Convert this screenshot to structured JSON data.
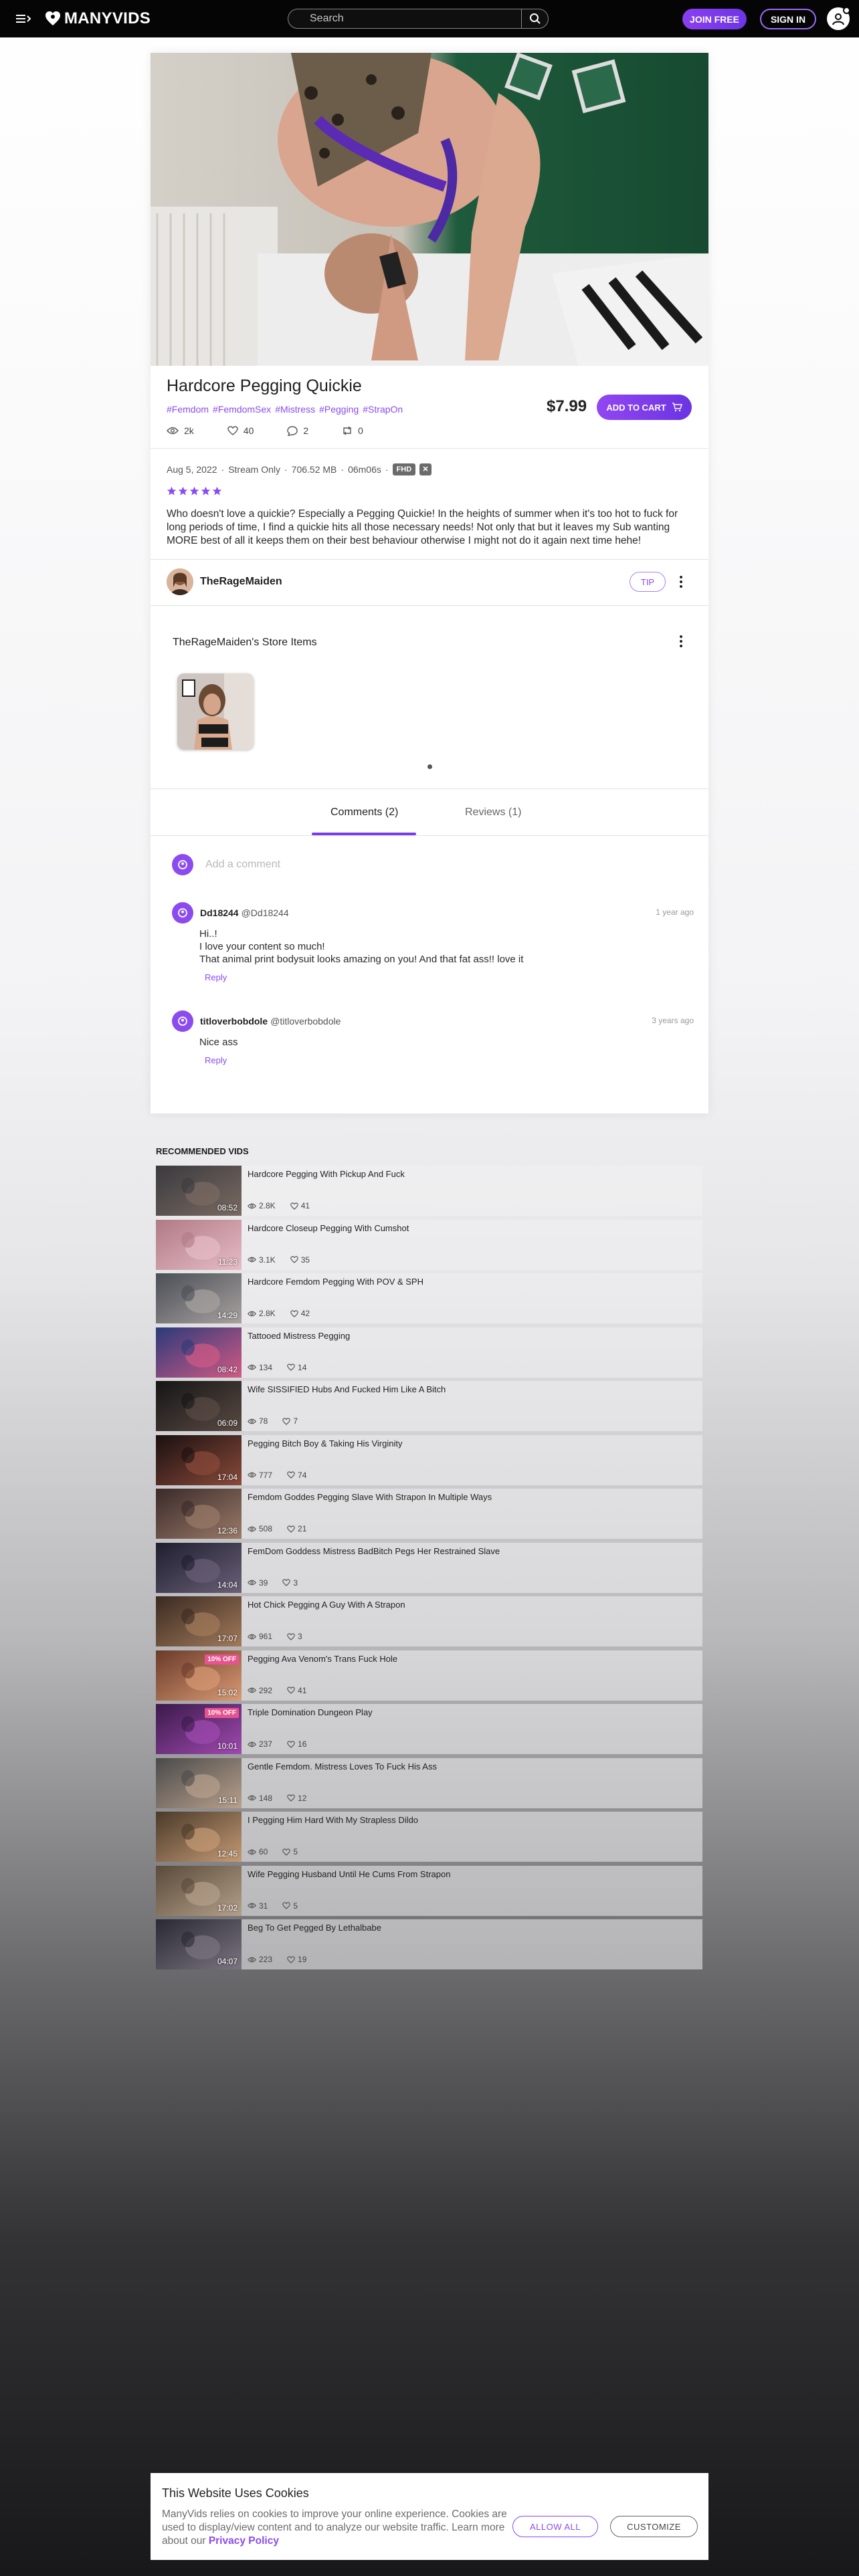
{
  "header": {
    "logo_text": "MANYVIDS",
    "search_placeholder": "Search",
    "join_label": "JOIN FREE",
    "signin_label": "SIGN IN"
  },
  "video": {
    "title": "Hardcore Pegging Quickie",
    "tags": [
      "#Femdom",
      "#FemdomSex",
      "#Mistress",
      "#Pegging",
      "#StrapOn"
    ],
    "stats": {
      "views": "2k",
      "likes": "40",
      "comments": "2",
      "reposts": "0"
    },
    "price": "$7.99",
    "add_to_cart_label": "ADD TO CART",
    "date": "Aug 5, 2022",
    "stream": "Stream Only",
    "size": "706.52 MB",
    "duration": "06m06s",
    "quality_badge": "FHD",
    "rating_stars": 5,
    "description": "Who doesn't love a quickie? Especially a Pegging Quickie! In the heights of summer when it's too hot to fuck for long periods of time, I find a quickie hits all those necessary needs! Not only that but it leaves my Sub wanting MORE best of all it keeps them on their best behaviour otherwise I might not do it again next time hehe!"
  },
  "creator": {
    "name": "TheRageMaiden",
    "tip_label": "TIP"
  },
  "store": {
    "title": "TheRageMaiden's Store Items"
  },
  "tabs": {
    "comments": "Comments (2)",
    "reviews": "Reviews (1)"
  },
  "comment_input_placeholder": "Add a comment",
  "comments": [
    {
      "user": "Dd18244",
      "handle": "@Dd18244",
      "time": "1 year ago",
      "lines": [
        "Hi..!",
        "I love your content so much!",
        "That animal print bodysuit looks amazing on you! And that fat ass!! love it"
      ],
      "reply": "Reply"
    },
    {
      "user": "titloverbobdole",
      "handle": "@titloverbobdole",
      "time": "3 years ago",
      "lines": [
        "Nice ass"
      ],
      "reply": "Reply"
    }
  ],
  "recommended": {
    "heading": "RECOMMENDED VIDS",
    "items": [
      {
        "title": "Hardcore Pegging With Pickup And Fuck",
        "duration": "08:52",
        "views": "2.8K",
        "likes": "41",
        "badge": ""
      },
      {
        "title": "Hardcore Closeup Pegging With Cumshot",
        "duration": "11:23",
        "views": "3.1K",
        "likes": "35",
        "badge": ""
      },
      {
        "title": "Hardcore Femdom Pegging With POV & SPH",
        "duration": "14:29",
        "views": "2.8K",
        "likes": "42",
        "badge": ""
      },
      {
        "title": "Tattooed Mistress Pegging",
        "duration": "08:42",
        "views": "134",
        "likes": "14",
        "badge": ""
      },
      {
        "title": "Wife SISSIFIED Hubs And Fucked Him Like A Bitch",
        "duration": "06:09",
        "views": "78",
        "likes": "7",
        "badge": ""
      },
      {
        "title": "Pegging Bitch Boy & Taking His Virginity",
        "duration": "17:04",
        "views": "777",
        "likes": "74",
        "badge": ""
      },
      {
        "title": "Femdom Goddes Pegging Slave With Strapon In Multiple Ways",
        "duration": "12:36",
        "views": "508",
        "likes": "21",
        "badge": ""
      },
      {
        "title": "FemDom Goddess Mistress BadBitch Pegs Her Restrained Slave",
        "duration": "14:04",
        "views": "39",
        "likes": "3",
        "badge": ""
      },
      {
        "title": "Hot Chick Pegging A Guy With A Strapon",
        "duration": "17:07",
        "views": "961",
        "likes": "3",
        "badge": ""
      },
      {
        "title": "Pegging Ava Venom's Trans Fuck Hole",
        "duration": "15:02",
        "views": "292",
        "likes": "41",
        "badge": "10% OFF"
      },
      {
        "title": "Triple Domination Dungeon Play",
        "duration": "10:01",
        "views": "237",
        "likes": "16",
        "badge": "10% OFF"
      },
      {
        "title": "Gentle Femdom. Mistress Loves To Fuck His Ass",
        "duration": "15:11",
        "views": "148",
        "likes": "12",
        "badge": ""
      },
      {
        "title": "I Pegging Him Hard With My Strapless Dildo",
        "duration": "12:45",
        "views": "60",
        "likes": "5",
        "badge": ""
      },
      {
        "title": "Wife Pegging Husband Until He Cums From Strapon",
        "duration": "17:02",
        "views": "31",
        "likes": "5",
        "badge": ""
      },
      {
        "title": "Beg To Get Pegged By Lethalbabe",
        "duration": "04:07",
        "views": "223",
        "likes": "19",
        "badge": ""
      }
    ]
  },
  "cookie": {
    "title": "This Website Uses Cookies",
    "text": "ManyVids relies on cookies to improve your online experience. Cookies are used to display/view content and to analyze our website traffic. Learn more about our",
    "link": "Privacy Policy",
    "allow_label": "ALLOW ALL",
    "customize_label": "CUSTOMIZE"
  },
  "colors": {
    "accent": "#8b4bf0",
    "header_bg": "#050505"
  }
}
